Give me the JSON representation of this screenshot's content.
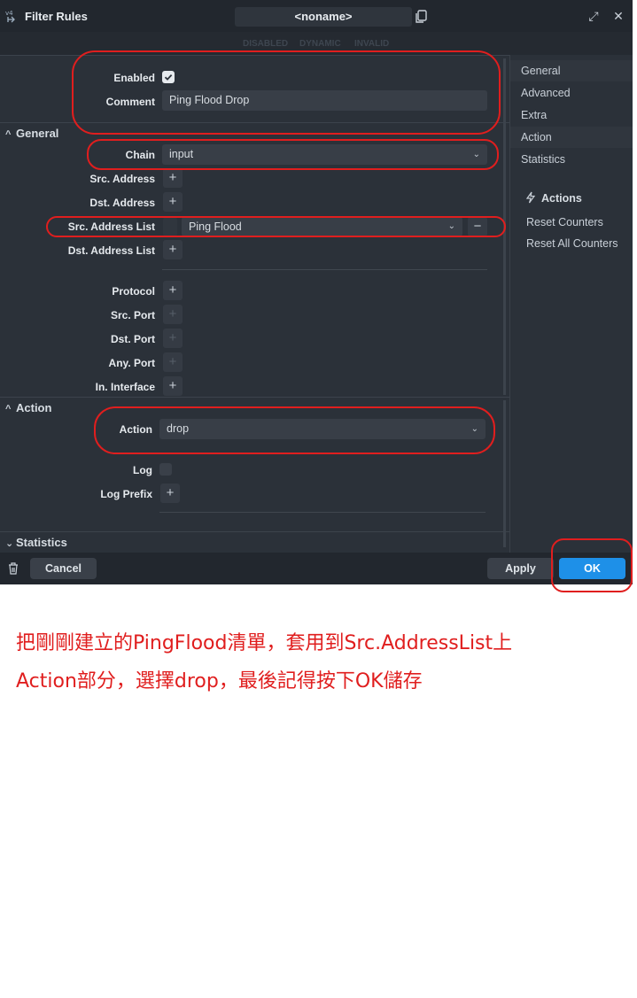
{
  "window": {
    "title": "Filter Rules",
    "name": "<noname>",
    "status_flags": [
      "DISABLED",
      "DYNAMIC",
      "INVALID"
    ]
  },
  "rule": {
    "enabled_label": "Enabled",
    "enabled": true,
    "comment_label": "Comment",
    "comment_value": "Ping Flood Drop"
  },
  "general": {
    "header": "General",
    "chain_label": "Chain",
    "chain_value": "input",
    "src_address_label": "Src. Address",
    "dst_address_label": "Dst. Address",
    "src_address_list_label": "Src. Address List",
    "src_address_list_value": "Ping Flood",
    "dst_address_list_label": "Dst. Address List",
    "protocol_label": "Protocol",
    "src_port_label": "Src. Port",
    "dst_port_label": "Dst. Port",
    "any_port_label": "Any. Port",
    "in_interface_label": "In. Interface"
  },
  "action": {
    "header": "Action",
    "action_label": "Action",
    "action_value": "drop",
    "log_label": "Log",
    "log_enabled": false,
    "log_prefix_label": "Log Prefix"
  },
  "statistics": {
    "header": "Statistics"
  },
  "sidebar": {
    "nav": [
      "General",
      "Advanced",
      "Extra",
      "Action",
      "Statistics"
    ],
    "actions_title": "Actions",
    "actions": [
      "Reset Counters",
      "Reset All Counters"
    ]
  },
  "footer": {
    "cancel": "Cancel",
    "apply": "Apply",
    "ok": "OK"
  },
  "caption": {
    "line1": "把剛剛建立的PingFlood清單，套用到Src.AddressList上",
    "line2": "Action部分，選擇drop，最後記得按下OK儲存"
  },
  "colors": {
    "highlight": "#e01e1e",
    "ok_button": "#1e90e8",
    "background": "#2b3139"
  }
}
